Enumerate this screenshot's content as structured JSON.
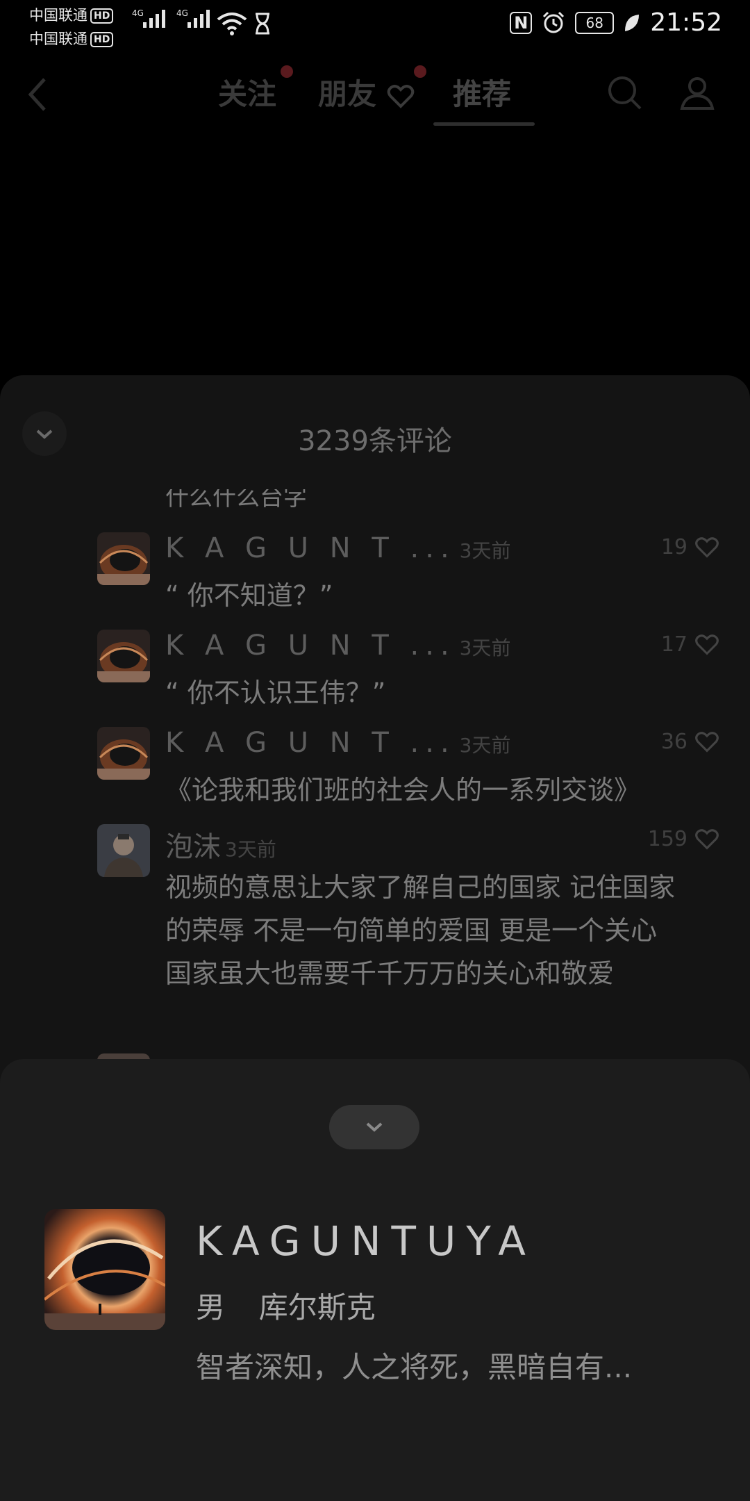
{
  "status_bar": {
    "carrier1": "中国联通",
    "carrier2": "中国联通",
    "hd_badge": "HD",
    "net_type": "4G",
    "battery": "68",
    "time": "21:52"
  },
  "nav": {
    "tabs": [
      "关注",
      "朋友",
      "推荐"
    ],
    "active_tab": "推荐"
  },
  "comments_sheet": {
    "title": "3239条评论",
    "partial_text": "什么什么台字",
    "comments": [
      {
        "name": "K A G U N T ...",
        "time": "3天前",
        "text": "“ 你不知道？”",
        "likes": "19"
      },
      {
        "name": "K A G U N T ...",
        "time": "3天前",
        "text": "“ 你不认识王伟？”",
        "likes": "17"
      },
      {
        "name": "K A G U N T ...",
        "time": "3天前",
        "text": "《论我和我们班的社会人的一系列交谈》",
        "likes": "36"
      },
      {
        "name": "泡沫",
        "time": "3天前",
        "text": "视频的意思让大家了解自己的国家 记住国家的荣辱  不是一句简单的爱国  更是一个关心 国家虽大也需要千千万万的关心和敬爱",
        "likes": "159"
      }
    ]
  },
  "profile_sheet": {
    "name": "KAGUNTUYA",
    "gender": "男",
    "location": "库尔斯克",
    "bio": "智者深知，人之将死，黑暗自有..."
  },
  "colors": {
    "background": "#000000",
    "sheet": "#141414",
    "profile_sheet": "#1c1c1c",
    "badge_dot": "#5a1a1e"
  }
}
